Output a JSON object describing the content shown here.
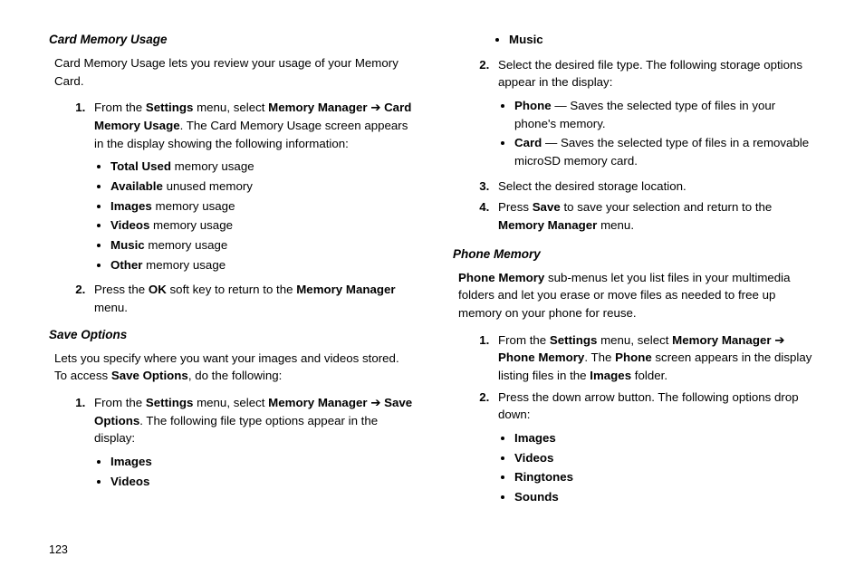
{
  "page_number": "123",
  "left": {
    "sec1": {
      "title": "Card Memory Usage",
      "intro": "Card Memory Usage lets you review your usage of your Memory Card.",
      "s1a": "From the ",
      "s1b": "Settings",
      "s1c": " menu, select ",
      "s1d": "Memory Manager ",
      "s1e": " Card Memory Usage",
      "s1f": ". The Card Memory Usage screen appears in the display showing the following information:",
      "bullets": {
        "b1a": "Total Used",
        "b1b": " memory usage",
        "b2a": "Available",
        "b2b": " unused memory",
        "b3a": "Images",
        "b3b": " memory usage",
        "b4a": "Videos",
        "b4b": " memory usage",
        "b5a": "Music",
        "b5b": " memory usage",
        "b6a": "Other",
        "b6b": " memory usage"
      },
      "s2a": "Press the ",
      "s2b": "OK",
      "s2c": " soft key to return to the ",
      "s2d": "Memory Manager",
      "s2e": " menu."
    },
    "sec2": {
      "title": "Save Options",
      "intro1": "Lets you specify where you want your images and videos stored. To access ",
      "intro2": "Save Options",
      "intro3": ", do the following:",
      "s1a": "From the ",
      "s1b": "Settings",
      "s1c": " menu, select ",
      "s1d": "Memory Manager ",
      "s1e": " Save Options",
      "s1f": ". The following file type options appear in the display:",
      "bullets": {
        "b1": "Images",
        "b2": "Videos"
      }
    }
  },
  "right": {
    "topbullet": "Music",
    "s2": "Select the desired file type. The following storage options appear in the display:",
    "sb1a": "Phone",
    "sb1b": " — Saves the selected type of files in your phone's memory.",
    "sb2a": "Card",
    "sb2b": " — Saves the selected type of files in a removable microSD memory card.",
    "s3": "Select the desired storage location.",
    "s4a": "Press ",
    "s4b": "Save",
    "s4c": " to save your selection and return to the ",
    "s4d": "Memory Manager",
    "s4e": " menu.",
    "sec3": {
      "title": "Phone Memory",
      "intro1": "Phone Memory",
      "intro2": " sub-menus let you list files in your multimedia folders and let you erase or move files as needed to free up memory on your phone for reuse.",
      "s1a": "From the ",
      "s1b": "Settings",
      "s1c": " menu, select ",
      "s1d": "Memory Manager ",
      "s1e": " Phone Memory",
      "s1f": ". The ",
      "s1g": "Phone",
      "s1h": " screen appears in the display listing files in the ",
      "s1i": "Images",
      "s1j": " folder.",
      "s2": "Press the down arrow button. The following options drop down:",
      "bullets": {
        "b1": "Images",
        "b2": "Videos",
        "b3": "Ringtones",
        "b4": "Sounds"
      }
    }
  }
}
